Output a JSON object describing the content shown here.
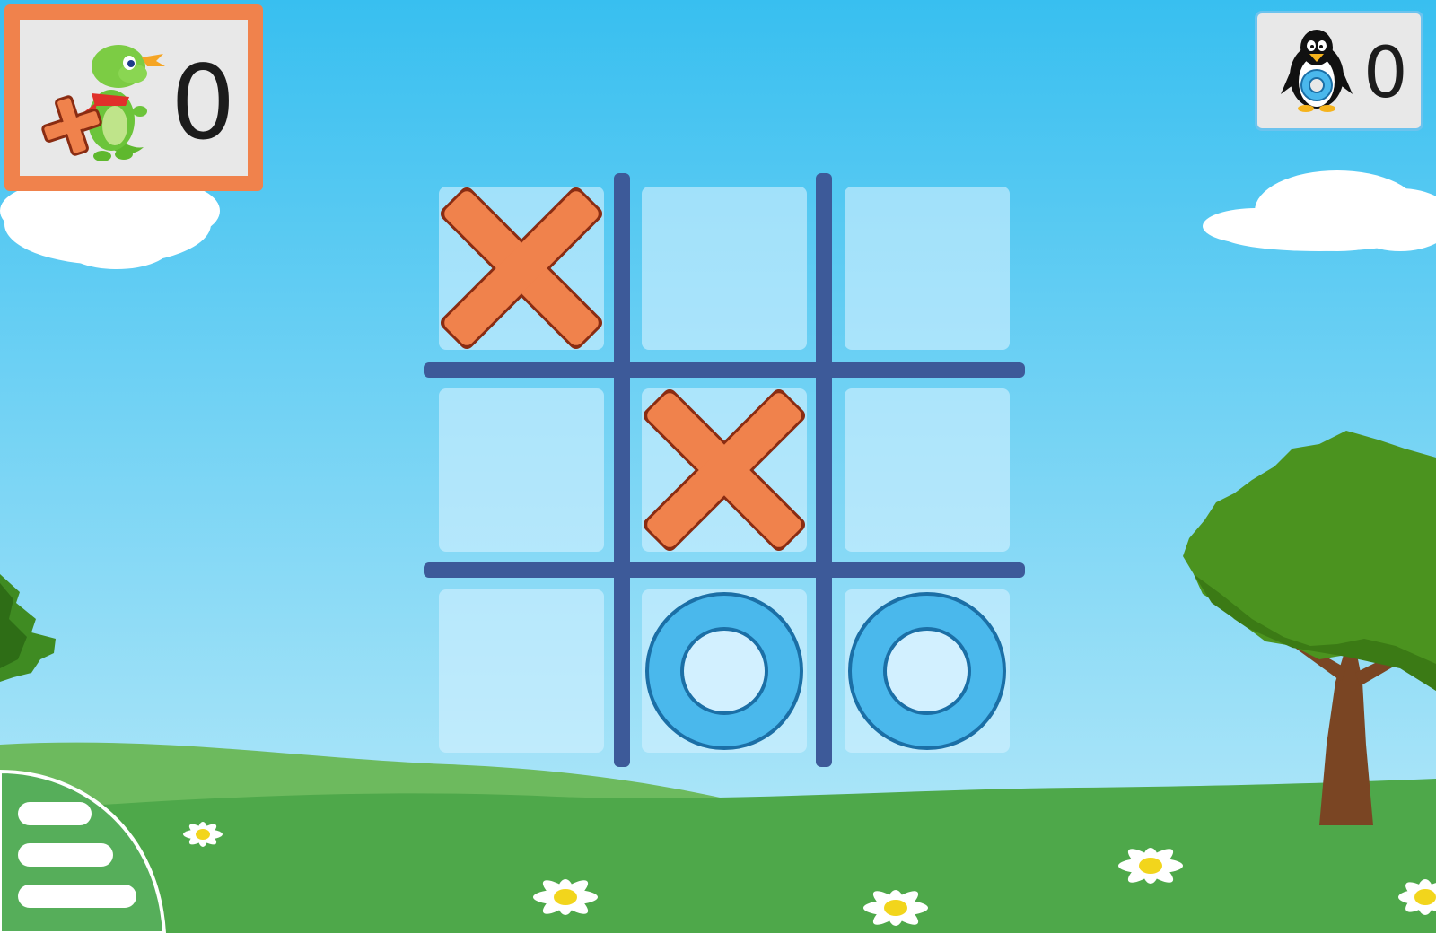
{
  "scores": {
    "player_x": "0",
    "player_o": "0"
  },
  "board": {
    "cells": [
      "X",
      "",
      "",
      "",
      "X",
      "",
      "",
      "O",
      "O"
    ],
    "active_player": "X"
  },
  "players": {
    "x_icon": "dragon-icon",
    "o_icon": "penguin-icon"
  },
  "colors": {
    "x_mark": "#f0824c",
    "x_mark_outline": "#8a2c12",
    "o_mark": "#4ab8ec",
    "o_mark_outline": "#1b6fa6",
    "grid": "#3d5a99",
    "active_player_border": "#f0824c",
    "sky_top": "#38bff0",
    "sky_bottom": "#a8e4f8",
    "grass": "#4ea84a"
  },
  "menu": {
    "icon": "hamburger-menu-icon"
  }
}
